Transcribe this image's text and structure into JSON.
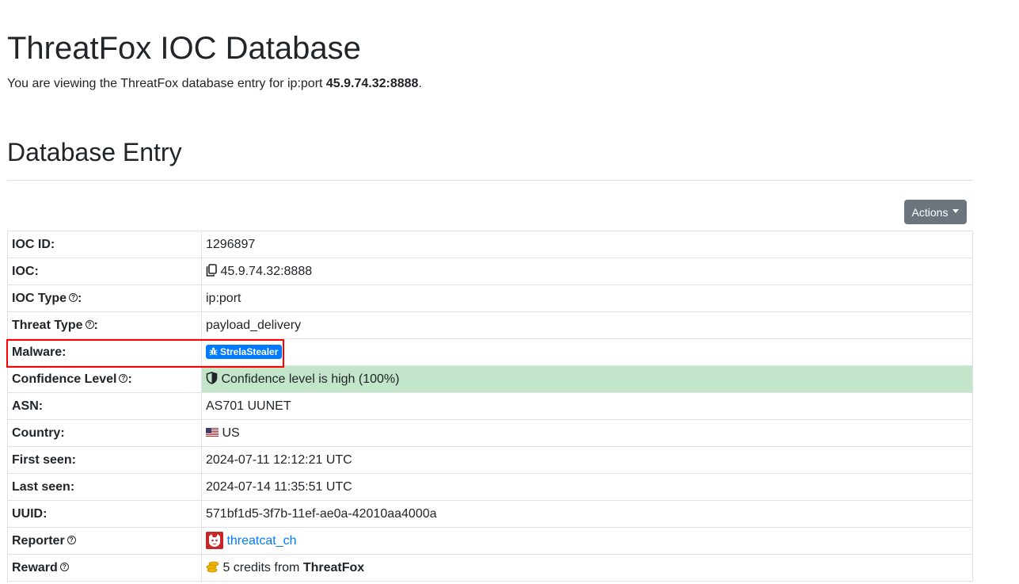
{
  "header": {
    "title": "ThreatFox IOC Database",
    "intro_prefix": "You are viewing the ThreatFox database entry for ip:port ",
    "intro_value": "45.9.74.32:8888",
    "intro_suffix": "."
  },
  "section": {
    "title": "Database Entry",
    "actions_label": "Actions"
  },
  "entry": {
    "ioc_id": {
      "label": "IOC ID:",
      "value": "1296897"
    },
    "ioc": {
      "label": "IOC:",
      "value": "45.9.74.32:8888"
    },
    "ioc_type": {
      "label": "IOC Type",
      "suffix": ":",
      "value": "ip:port"
    },
    "threat_type": {
      "label": "Threat Type",
      "suffix": ":",
      "value": "payload_delivery"
    },
    "malware": {
      "label": "Malware:",
      "badge": "StrelaStealer"
    },
    "confidence": {
      "label": "Confidence Level",
      "suffix": ":",
      "value": "Confidence level is high (100%)"
    },
    "asn": {
      "label": "ASN:",
      "value": "AS701 UUNET"
    },
    "country": {
      "label": "Country:",
      "value": "US"
    },
    "first_seen": {
      "label": "First seen:",
      "value": "2024-07-11 12:12:21 UTC"
    },
    "last_seen": {
      "label": "Last seen:",
      "value": "2024-07-14 11:35:51 UTC"
    },
    "uuid": {
      "label": "UUID:",
      "value": "571bf1d5-3f7b-11ef-ae0a-42010aa4000a"
    },
    "reporter": {
      "label": "Reporter",
      "value": "threatcat_ch"
    },
    "reward": {
      "label": "Reward",
      "value_prefix": "5 credits from ",
      "value_bold": "ThreatFox"
    }
  },
  "icons": {
    "help": "question-circle-icon",
    "copy": "copy-icon",
    "bug": "bug-icon",
    "shield": "shield-half-icon",
    "flag": "us-flag-icon",
    "avatar": "threatcat-avatar-icon",
    "coins": "coins-icon"
  },
  "colors": {
    "badge": "#007bff",
    "link": "#007bff",
    "success_row": "#c3e6cb",
    "actions_button": "#6c757d",
    "highlight": "#ff0000"
  }
}
